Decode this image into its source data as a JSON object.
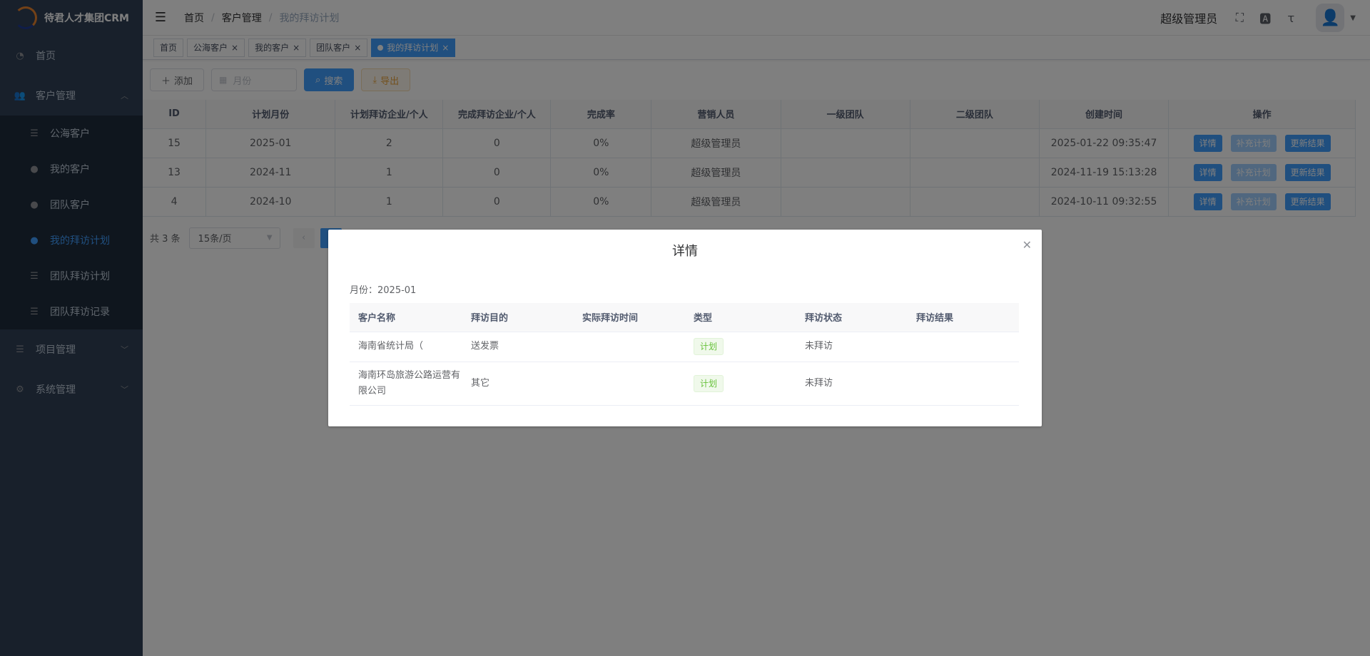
{
  "app": {
    "title": "待君人才集团CRM"
  },
  "sidebar": {
    "home": {
      "label": "首页",
      "icon": "dashboard-icon"
    },
    "customer": {
      "label": "客户管理",
      "icon": "users-icon",
      "items": [
        {
          "label": "公海客户",
          "icon": "list-icon"
        },
        {
          "label": "我的客户",
          "icon": "user-icon"
        },
        {
          "label": "团队客户",
          "icon": "users-icon"
        },
        {
          "label": "我的拜访计划",
          "icon": "user-icon",
          "active": true
        },
        {
          "label": "团队拜访计划",
          "icon": "list-icon"
        },
        {
          "label": "团队拜访记录",
          "icon": "list-icon"
        }
      ]
    },
    "project": {
      "label": "项目管理",
      "icon": "list-icon"
    },
    "system": {
      "label": "系统管理",
      "icon": "settings-icon"
    }
  },
  "header": {
    "breadcrumb": [
      "首页",
      "客户管理",
      "我的拜访计划"
    ],
    "username": "超级管理员"
  },
  "tags": [
    {
      "label": "首页",
      "closable": false
    },
    {
      "label": "公海客户",
      "closable": true
    },
    {
      "label": "我的客户",
      "closable": true
    },
    {
      "label": "团队客户",
      "closable": true
    },
    {
      "label": "我的拜访计划",
      "closable": true,
      "active": true
    }
  ],
  "toolbar": {
    "add_label": "添加",
    "month_placeholder": "月份",
    "search_label": "搜索",
    "export_label": "导出"
  },
  "table": {
    "columns": [
      "ID",
      "计划月份",
      "计划拜访企业/个人",
      "完成拜访企业/个人",
      "完成率",
      "营销人员",
      "一级团队",
      "二级团队",
      "创建时间",
      "操作"
    ],
    "rows": [
      {
        "id": "15",
        "month": "2025-01",
        "planned": "2",
        "done": "0",
        "rate": "0%",
        "sales": "超级管理员",
        "team1": "",
        "team2": "",
        "created": "2025-01-22 09:35:47"
      },
      {
        "id": "13",
        "month": "2024-11",
        "planned": "1",
        "done": "0",
        "rate": "0%",
        "sales": "超级管理员",
        "team1": "",
        "team2": "",
        "created": "2024-11-19 15:13:28"
      },
      {
        "id": "4",
        "month": "2024-10",
        "planned": "1",
        "done": "0",
        "rate": "0%",
        "sales": "超级管理员",
        "team1": "",
        "team2": "",
        "created": "2024-10-11 09:32:55"
      }
    ],
    "actions": {
      "detail": "详情",
      "supplement": "补充计划",
      "update": "更新结果"
    }
  },
  "pagination": {
    "total_text": "共 3 条",
    "page_size": "15条/页"
  },
  "dialog": {
    "title": "详情",
    "month_label": "月份：2025-01",
    "columns": [
      "客户名称",
      "拜访目的",
      "实际拜访时间",
      "类型",
      "拜访状态",
      "拜访结果"
    ],
    "rows": [
      {
        "customer": "海南省统计局（",
        "purpose": "送发票",
        "actual_time": "",
        "type": "计划",
        "status": "未拜访",
        "result": ""
      },
      {
        "customer": "海南环岛旅游公路运营有限公司",
        "purpose": "其它",
        "actual_time": "",
        "type": "计划",
        "status": "未拜访",
        "result": ""
      }
    ]
  },
  "colors": {
    "sidebar_bg": "#304156",
    "primary": "#409eff",
    "danger": "#f56c6c",
    "success": "#67c23a"
  }
}
